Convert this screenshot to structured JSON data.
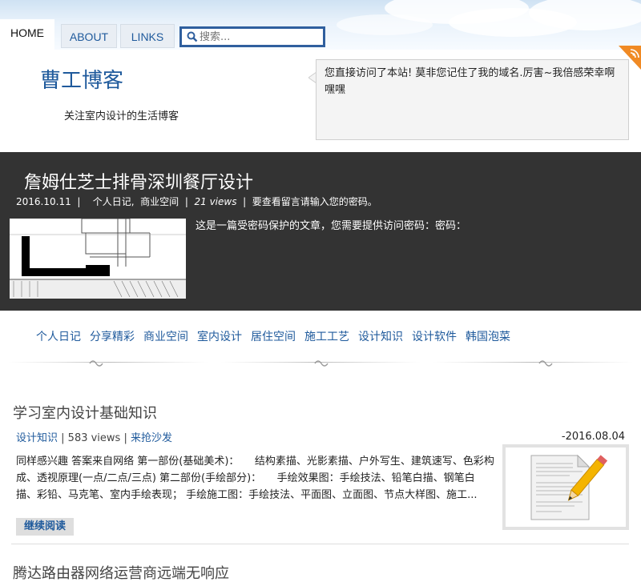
{
  "nav": {
    "tabs": [
      "HOME",
      "ABOUT",
      "LINKS"
    ],
    "search_placeholder": "搜索..."
  },
  "header": {
    "title": "曹工博客",
    "tagline": "关注室内设计的生活博客",
    "notice": "您直接访问了本站! 莫非您记住了我的域名.厉害~我倍感荣幸啊 嘿嘿"
  },
  "feature": {
    "title": "詹姆仕芝士排骨深圳餐厅设计",
    "date": "2016.10.11",
    "cat1": "个人日记",
    "cat2": "商业空间",
    "views": "21 views",
    "comment_note": "要查看留言请输入您的密码。",
    "text": "这是一篇受密码保护的文章，您需要提供访问密码：密码："
  },
  "categories": [
    "个人日记",
    "分享精彩",
    "商业空间",
    "室内设计",
    "居住空间",
    "施工工艺",
    "设计知识",
    "设计软件",
    "韩国泡菜"
  ],
  "post": {
    "title": "学习室内设计基础知识",
    "category": "设计知识",
    "views": "583 views",
    "comment": "来抢沙发",
    "date": "-2016.08.04",
    "excerpt": "同样感兴趣 答案来自网络 第一部份(基础美术)：　　结构素描、光影素描、户外写生、建筑速写、色彩构成、透视原理(一点/二点/三点) 第二部份(手绘部分)：　　手绘效果图：手绘技法、铅笔白描、钢笔白描、彩铅、马克笔、室内手绘表现； 手绘施工图：手绘技法、平面图、立面图、节点大样图、施工...",
    "more_label": "继续阅读"
  },
  "next_post": {
    "title": "腾达路由器网络运营商远端无响应"
  },
  "colors": {
    "link": "#1f5a9c",
    "dark_band": "#333333",
    "rss": "#f08a24"
  }
}
